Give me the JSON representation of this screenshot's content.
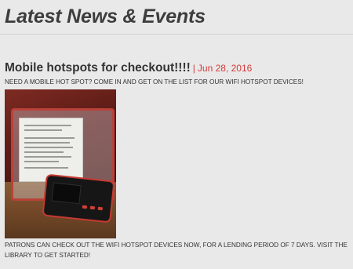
{
  "section": {
    "title": "Latest News & Events"
  },
  "post": {
    "title": "Mobile hotspots for checkout!!!!",
    "separator": "|",
    "date": "Jun 28, 2016",
    "intro": "NEED A MOBILE HOT SPOT? COME IN AND GET ON THE LIST FOR OUR WIFI HOTSPOT DEVICES!",
    "body": "PATRONS CAN CHECK OUT THE WIFI HOTSPOT DEVICES NOW, FOR A LENDING PERIOD OF 7 DAYS. VISIT THE LIBRARY TO GET STARTED!",
    "accent_color": "#d43a3a"
  }
}
